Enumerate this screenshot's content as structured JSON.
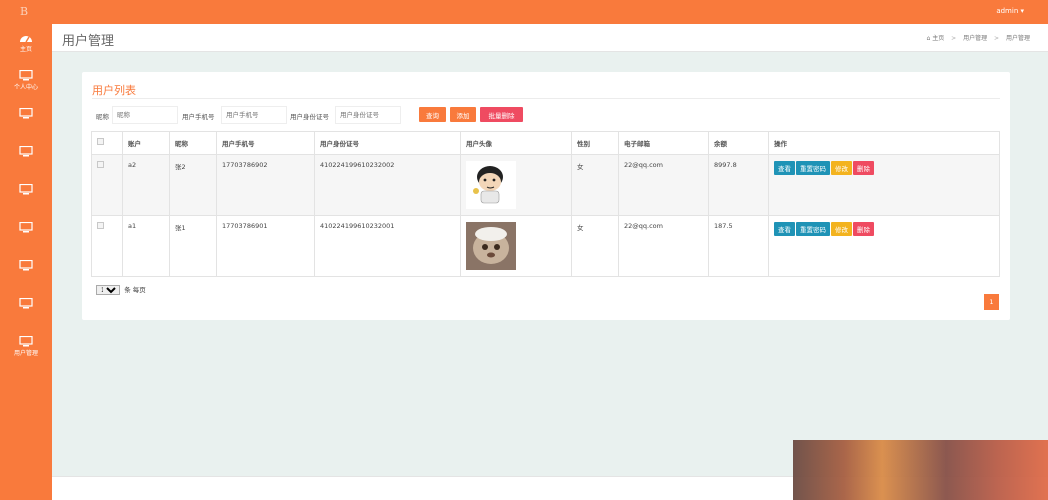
{
  "topbar": {
    "user": "admin ▾",
    "user_color": "#ffffff",
    "bar_color": "#f97a3c"
  },
  "sidebar": {
    "items": [
      {
        "label": "主页",
        "icon": "dashboard-icon"
      },
      {
        "label": "个人中心",
        "icon": "monitor-icon"
      },
      {
        "label": "",
        "icon": "monitor-icon"
      },
      {
        "label": "",
        "icon": "monitor-icon"
      },
      {
        "label": "",
        "icon": "monitor-icon"
      },
      {
        "label": "",
        "icon": "monitor-icon"
      },
      {
        "label": "",
        "icon": "monitor-icon"
      },
      {
        "label": "",
        "icon": "monitor-icon"
      },
      {
        "label": "用户管理",
        "icon": "monitor-icon"
      }
    ]
  },
  "header": {
    "title": "用户管理",
    "breadcrumb": [
      "主页",
      "用户管理",
      "用户管理"
    ]
  },
  "card": {
    "title": "用户列表",
    "search": {
      "nickname_label": "昵称",
      "nickname_placeholder": "昵称",
      "phone_label": "用户手机号",
      "phone_placeholder": "用户手机号",
      "idcard_label": "用户身份证号",
      "idcard_placeholder": "用户身份证号",
      "query_button": "查询",
      "add_button": "添加",
      "batch_delete_button": "批量删除"
    },
    "table": {
      "columns": [
        "",
        "账户",
        "昵称",
        "用户手机号",
        "用户身份证号",
        "用户头像",
        "性别",
        "电子邮箱",
        "余额",
        "操作"
      ],
      "rows": [
        {
          "account": "a2",
          "nickname": "张2",
          "phone": "17703786902",
          "idcard": "410224199610232002",
          "gender": "女",
          "email": "22@qq.com",
          "balance": "8997.8"
        },
        {
          "account": "a1",
          "nickname": "张1",
          "phone": "17703786901",
          "idcard": "410224199610232001",
          "gender": "女",
          "email": "22@qq.com",
          "balance": "187.5"
        }
      ],
      "actions": {
        "view": "查看",
        "reset_password": "重置密码",
        "edit": "修改",
        "delete": "删除"
      }
    },
    "pager": {
      "page_size_value": "10",
      "page_size_suffix": "条 每页",
      "current_page": "1"
    }
  }
}
